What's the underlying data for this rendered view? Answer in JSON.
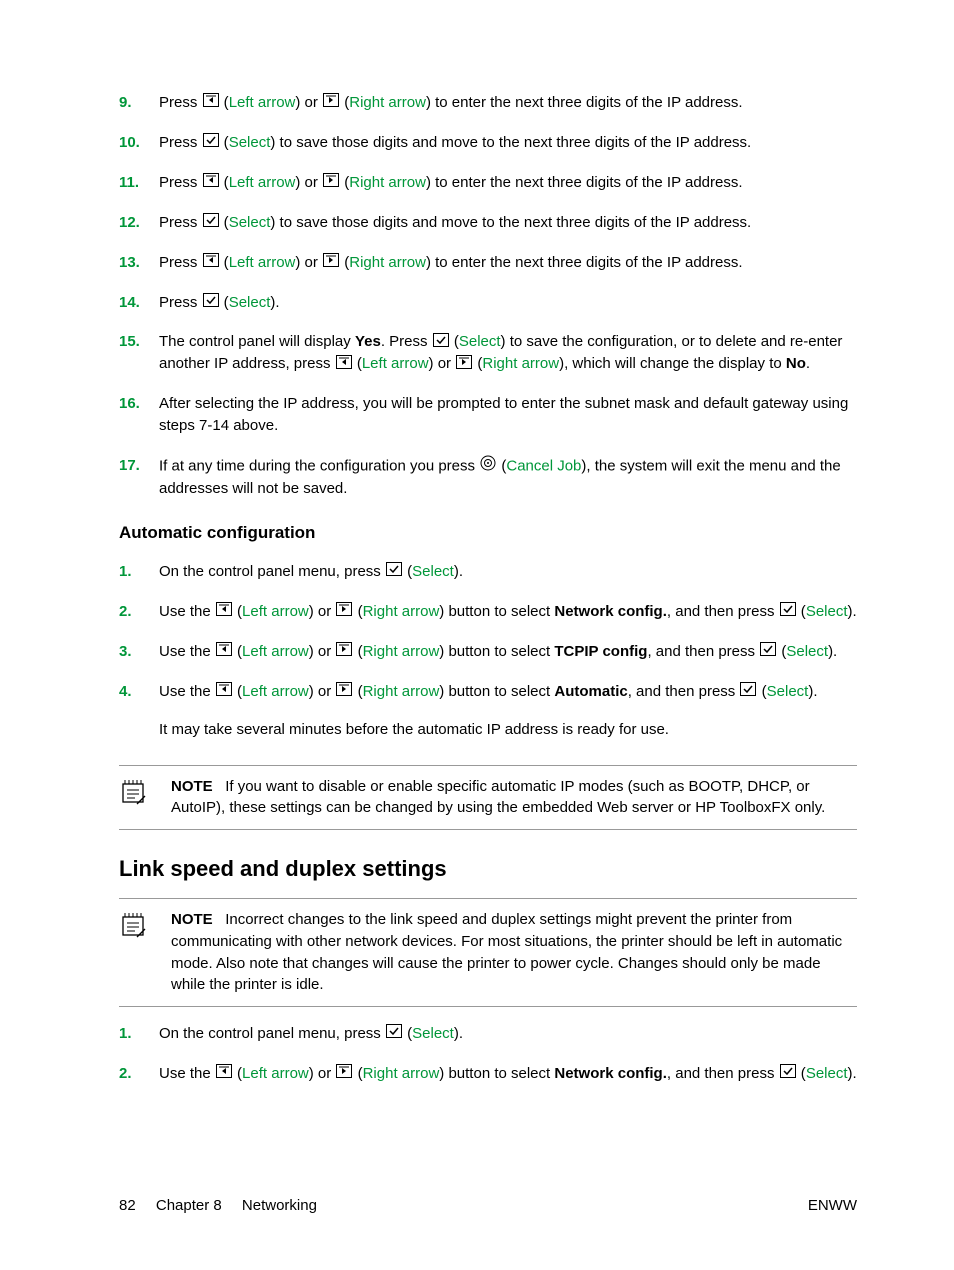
{
  "labels": {
    "leftArrow": "Left arrow",
    "rightArrow": "Right arrow",
    "select": "Select",
    "cancelJob": "Cancel Job",
    "note": "NOTE"
  },
  "steps1": {
    "s9": {
      "num": "9.",
      "a": "Press ",
      "b": " (",
      "c": ") or ",
      "d": " (",
      "e": ") to enter the next three digits of the IP address."
    },
    "s10": {
      "num": "10.",
      "a": "Press ",
      "b": " (",
      "c": ") to save those digits and move to the next three digits of the IP address."
    },
    "s11": {
      "num": "11.",
      "a": "Press ",
      "b": " (",
      "c": ") or ",
      "d": " (",
      "e": ") to enter the next three digits of the IP address."
    },
    "s12": {
      "num": "12.",
      "a": "Press ",
      "b": " (",
      "c": ") to save those digits and move to the next three digits of the IP address."
    },
    "s13": {
      "num": "13.",
      "a": "Press ",
      "b": " (",
      "c": ") or ",
      "d": " (",
      "e": ") to enter the next three digits of the IP address."
    },
    "s14": {
      "num": "14.",
      "a": "Press ",
      "b": " (",
      "c": ")."
    },
    "s15": {
      "num": "15.",
      "a": "The control panel will display ",
      "yes": "Yes",
      "b": ". Press ",
      "c": " (",
      "d": ") to save the configuration, or to delete and re-enter another IP address, press ",
      "e": " (",
      "f": ") or ",
      "g": " (",
      "h": "), which will change the display to ",
      "no": "No",
      "i": "."
    },
    "s16": {
      "num": "16.",
      "text": "After selecting the IP address, you will be prompted to enter the subnet mask and default gateway using steps 7-14 above."
    },
    "s17": {
      "num": "17.",
      "a": "If at any time during the configuration you press ",
      "b": " (",
      "c": "), the system will exit the menu and the addresses will not be saved."
    }
  },
  "headings": {
    "autoConfig": "Automatic configuration",
    "linkSpeed": "Link speed and duplex settings"
  },
  "steps2": {
    "s1": {
      "num": "1.",
      "a": "On the control panel menu, press ",
      "b": " (",
      "c": ")."
    },
    "s2": {
      "num": "2.",
      "a": "Use the ",
      "b": " (",
      "c": ") or ",
      "d": " (",
      "e": ") button to select ",
      "net": "Network config.",
      "f": ", and then press ",
      "g": " (",
      "h": ")."
    },
    "s3": {
      "num": "3.",
      "a": "Use the ",
      "b": " (",
      "c": ") or ",
      "d": " (",
      "e": ") button to select ",
      "tcp": "TCPIP config",
      "f": ", and then press ",
      "g": " (",
      "h": ")."
    },
    "s4": {
      "num": "4.",
      "a": "Use the ",
      "b": " (",
      "c": ") or ",
      "d": " (",
      "e": ") button to select ",
      "auto": "Automatic",
      "f": ", and then press ",
      "g": " (",
      "h": ").",
      "tail": "It may take several minutes before the automatic IP address is ready for use."
    }
  },
  "note1": "If you want to disable or enable specific automatic IP modes (such as BOOTP, DHCP, or AutoIP), these settings can be changed by using the embedded Web server or HP ToolboxFX only.",
  "note2": "Incorrect changes to the link speed and duplex settings might prevent the printer from communicating with other network devices. For most situations, the printer should be left in automatic mode. Also note that changes will cause the printer to power cycle. Changes should only be made while the printer is idle.",
  "steps3": {
    "s1": {
      "num": "1.",
      "a": "On the control panel menu, press ",
      "b": " (",
      "c": ")."
    },
    "s2": {
      "num": "2.",
      "a": "Use the ",
      "b": " (",
      "c": ") or ",
      "d": " (",
      "e": ") button to select ",
      "net": "Network config.",
      "f": ", and then press ",
      "g": " (",
      "h": ")."
    }
  },
  "footer": {
    "pageNum": "82",
    "chapter": "Chapter 8",
    "section": "Networking",
    "right": "ENWW"
  }
}
